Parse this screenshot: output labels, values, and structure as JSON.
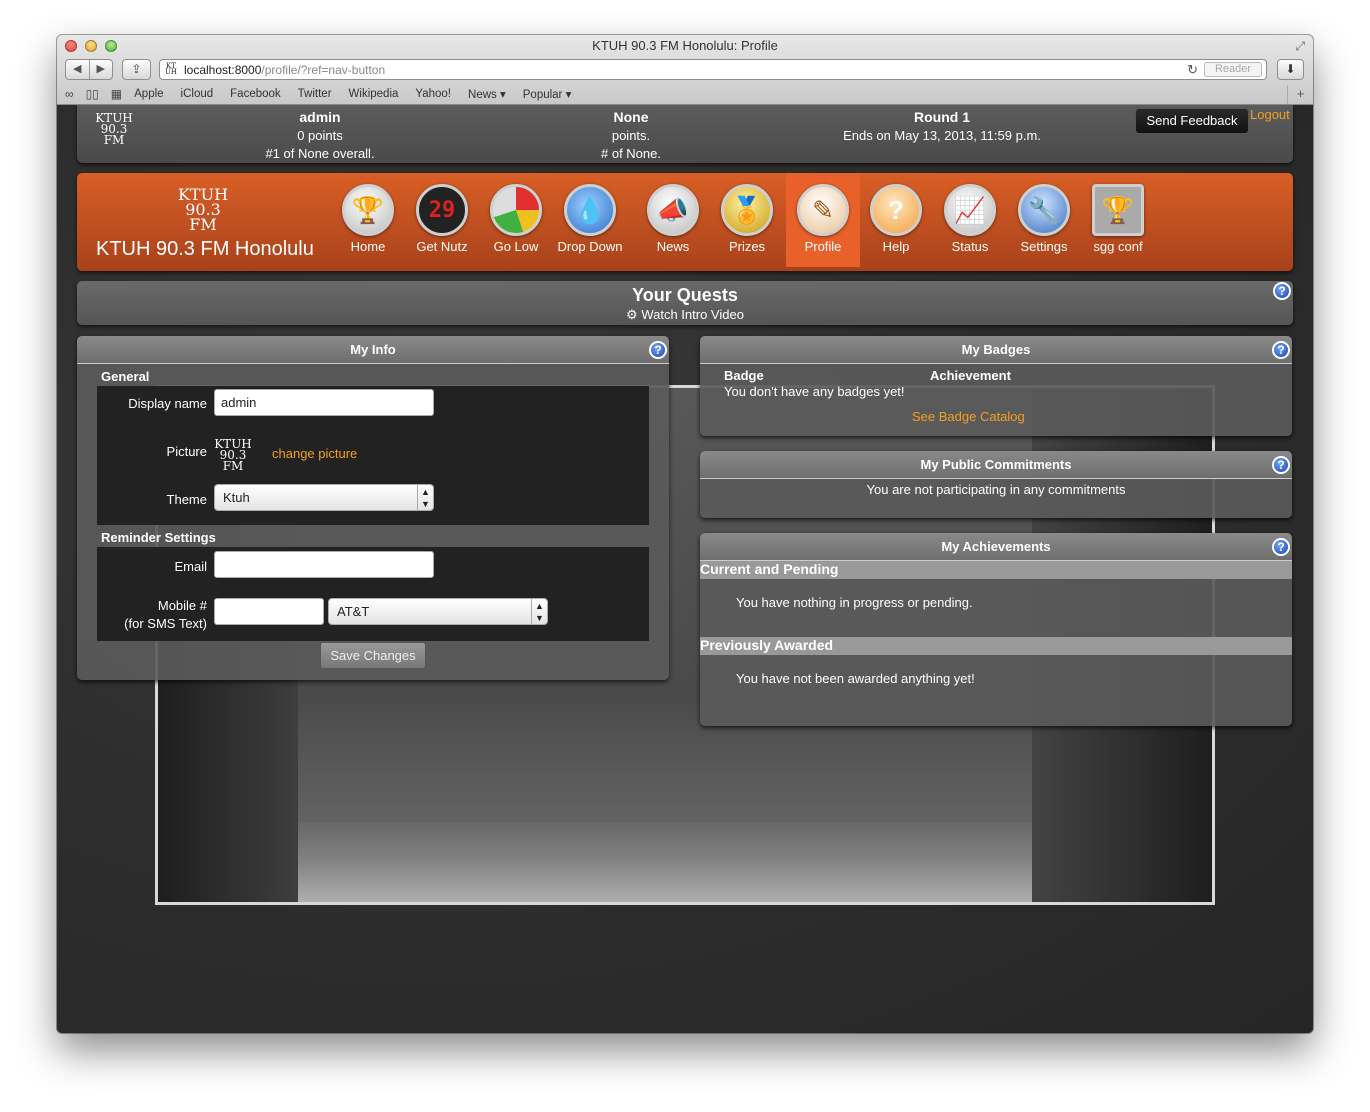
{
  "browser": {
    "window_title": "KTUH 90.3 FM Honolulu: Profile",
    "url_host": "localhost:8000",
    "url_path": "/profile/?ref=nav-button",
    "reader_label": "Reader",
    "bookmarks": [
      "Apple",
      "iCloud",
      "Facebook",
      "Twitter",
      "Wikipedia",
      "Yahoo!",
      "News ▾",
      "Popular ▾"
    ]
  },
  "stats": {
    "logo": [
      "KTUH",
      "90.3",
      "FM"
    ],
    "user_name": "admin",
    "user_points": "0 points",
    "user_rank": "#1 of None overall.",
    "team_name": "None",
    "team_points": "points.",
    "team_rank": "# of None.",
    "round_name": "Round 1",
    "round_ends": "Ends on May 13, 2013, 11:59 p.m.",
    "feedback_label": "Send Feedback",
    "logout_label": "Logout"
  },
  "nav": {
    "logo": [
      "KTUH",
      "90.3",
      "FM"
    ],
    "site_name": "KTUH 90.3 FM Honolulu",
    "items": [
      {
        "label": "Home",
        "icon": "trophy-icon"
      },
      {
        "label": "Get Nutz",
        "icon": "scoreboard-icon"
      },
      {
        "label": "Go Low",
        "icon": "gauge-icon"
      },
      {
        "label": "Drop Down",
        "icon": "water-drop-icon"
      },
      {
        "label": "News",
        "icon": "megaphone-icon"
      },
      {
        "label": "Prizes",
        "icon": "medal-icon"
      },
      {
        "label": "Profile",
        "icon": "profile-icon"
      },
      {
        "label": "Help",
        "icon": "question-icon"
      },
      {
        "label": "Status",
        "icon": "chart-icon"
      },
      {
        "label": "Settings",
        "icon": "wrench-icon"
      },
      {
        "label": "sgg conf",
        "icon": "trophies-icon"
      }
    ],
    "active": "Profile"
  },
  "quests": {
    "title": "Your Quests",
    "video_label": "Watch Intro Video"
  },
  "my_info": {
    "title": "My Info",
    "general_label": "General",
    "display_name_label": "Display name",
    "display_name_value": "admin",
    "picture_label": "Picture",
    "picture_logo": [
      "KTUH",
      "90.3",
      "FM"
    ],
    "change_picture_label": "change picture",
    "theme_label": "Theme",
    "theme_value": "Ktuh",
    "reminder_label": "Reminder Settings",
    "email_label": "Email",
    "email_value": "",
    "mobile_label": "Mobile #",
    "mobile_sub_label": "(for SMS Text)",
    "mobile_value": "",
    "carrier_value": "AT&T",
    "save_label": "Save Changes"
  },
  "badges": {
    "title": "My Badges",
    "col_badge": "Badge",
    "col_achievement": "Achievement",
    "empty_text": "You don't have any badges yet!",
    "catalog_label": "See Badge Catalog"
  },
  "commitments": {
    "title": "My Public Commitments",
    "empty_text": "You are not participating in any commitments"
  },
  "achievements": {
    "title": "My Achievements",
    "current_label": "Current and Pending",
    "current_text": "You have nothing in progress or pending.",
    "previous_label": "Previously Awarded",
    "previous_text": "You have not been awarded anything yet!"
  }
}
